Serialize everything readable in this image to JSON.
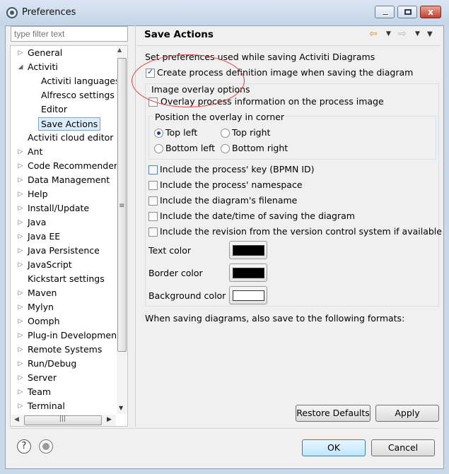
{
  "window": {
    "title": "Preferences"
  },
  "filter": {
    "placeholder": "type filter text"
  },
  "tree": {
    "items": [
      {
        "label": "General",
        "expander": "collapsed",
        "indent": 0
      },
      {
        "label": "Activiti",
        "expander": "expanded",
        "indent": 0
      },
      {
        "label": "Activiti languages",
        "expander": "none",
        "indent": 1
      },
      {
        "label": "Alfresco settings",
        "expander": "none",
        "indent": 1
      },
      {
        "label": "Editor",
        "expander": "none",
        "indent": 1
      },
      {
        "label": "Save Actions",
        "expander": "none",
        "indent": 1,
        "selected": true
      },
      {
        "label": "Activiti cloud editor",
        "expander": "none",
        "indent": 0
      },
      {
        "label": "Ant",
        "expander": "collapsed",
        "indent": 0
      },
      {
        "label": "Code Recommenders",
        "expander": "collapsed",
        "indent": 0
      },
      {
        "label": "Data Management",
        "expander": "collapsed",
        "indent": 0
      },
      {
        "label": "Help",
        "expander": "collapsed",
        "indent": 0
      },
      {
        "label": "Install/Update",
        "expander": "collapsed",
        "indent": 0
      },
      {
        "label": "Java",
        "expander": "collapsed",
        "indent": 0
      },
      {
        "label": "Java EE",
        "expander": "collapsed",
        "indent": 0
      },
      {
        "label": "Java Persistence",
        "expander": "collapsed",
        "indent": 0
      },
      {
        "label": "JavaScript",
        "expander": "collapsed",
        "indent": 0
      },
      {
        "label": "Kickstart settings",
        "expander": "none",
        "indent": 0
      },
      {
        "label": "Maven",
        "expander": "collapsed",
        "indent": 0
      },
      {
        "label": "Mylyn",
        "expander": "collapsed",
        "indent": 0
      },
      {
        "label": "Oomph",
        "expander": "collapsed",
        "indent": 0
      },
      {
        "label": "Plug-in Development",
        "expander": "collapsed",
        "indent": 0
      },
      {
        "label": "Remote Systems",
        "expander": "collapsed",
        "indent": 0
      },
      {
        "label": "Run/Debug",
        "expander": "collapsed",
        "indent": 0
      },
      {
        "label": "Server",
        "expander": "collapsed",
        "indent": 0
      },
      {
        "label": "Team",
        "expander": "collapsed",
        "indent": 0
      },
      {
        "label": "Terminal",
        "expander": "collapsed",
        "indent": 0
      }
    ]
  },
  "page": {
    "title": "Save Actions",
    "intro": "Set preferences used while saving Activiti Diagrams",
    "create_image": {
      "label": "Create process definition image when saving the diagram",
      "checked": true
    },
    "overlay_group": {
      "legend": "Image overlay options",
      "overlay_info": {
        "label": "Overlay process information on the process image",
        "checked": false
      },
      "corner_group": {
        "legend": "Position the overlay in corner",
        "options": [
          {
            "label": "Top left",
            "checked": true
          },
          {
            "label": "Top right",
            "checked": false
          },
          {
            "label": "Bottom left",
            "checked": false
          },
          {
            "label": "Bottom right",
            "checked": false
          }
        ]
      },
      "includes": [
        {
          "label": "Include the process' key (BPMN ID)",
          "checked": false
        },
        {
          "label": "Include the process' namespace",
          "checked": false
        },
        {
          "label": "Include the diagram's filename",
          "checked": false
        },
        {
          "label": "Include the date/time of saving the diagram",
          "checked": false
        },
        {
          "label": "Include the revision from the version control system if available",
          "checked": false
        }
      ],
      "colors": [
        {
          "label": "Text color",
          "value": "#000000"
        },
        {
          "label": "Border color",
          "value": "#000000"
        },
        {
          "label": "Background color",
          "value": "#ffffff"
        }
      ]
    },
    "formats_label": "When saving diagrams, also save to the following formats:"
  },
  "buttons": {
    "restore_defaults": "Restore Defaults",
    "apply": "Apply",
    "ok": "OK",
    "cancel": "Cancel"
  },
  "icons": {
    "help": "?",
    "close": "x"
  },
  "colors": {
    "annotation": "#e04040",
    "selection": "#dbecfc",
    "close_button": "#c2412b"
  }
}
